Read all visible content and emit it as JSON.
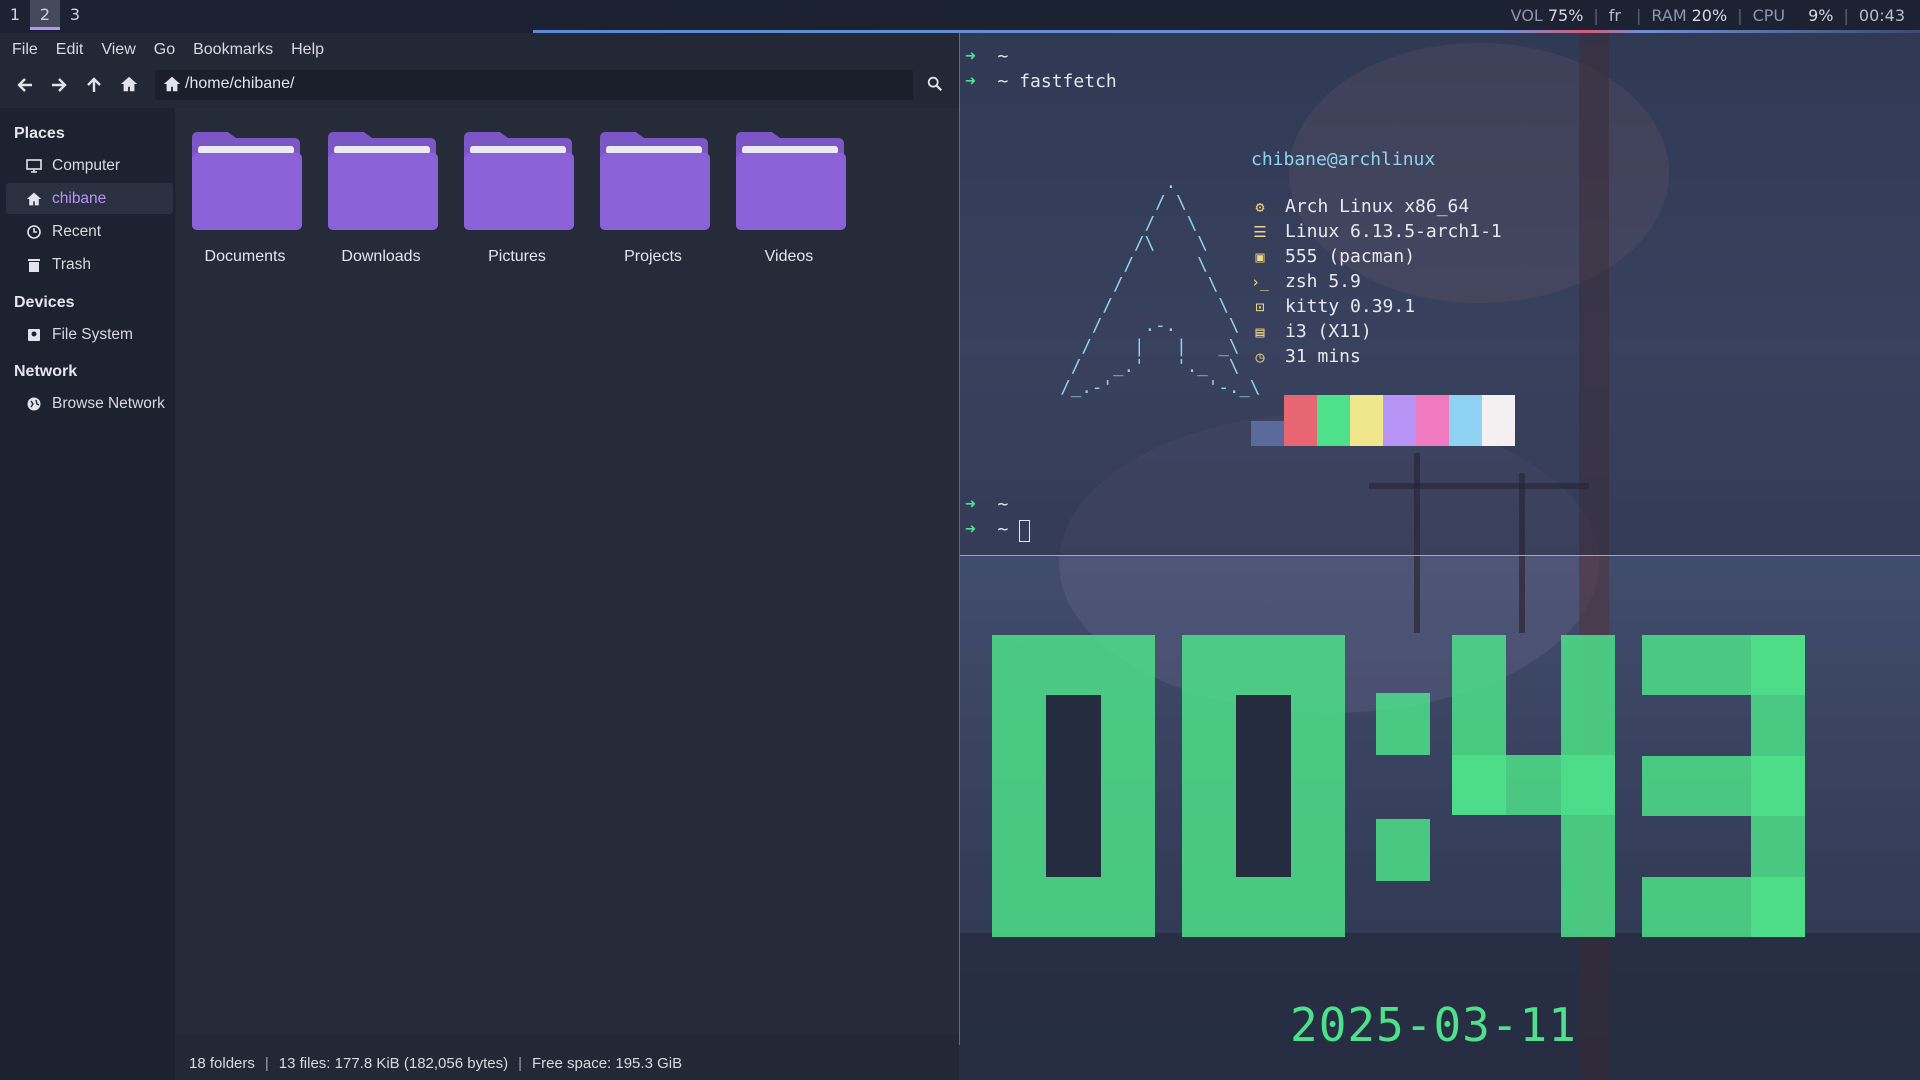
{
  "topbar": {
    "workspaces": [
      "1",
      "2",
      "3"
    ],
    "active_workspace": "2",
    "vol_label": "VOL",
    "vol_value": "75%",
    "layout": "fr",
    "ram_label": "RAM",
    "ram_value": "20%",
    "cpu_label": "CPU",
    "cpu_value": "9%",
    "time": "00:43"
  },
  "filemanager": {
    "menu": [
      "File",
      "Edit",
      "View",
      "Go",
      "Bookmarks",
      "Help"
    ],
    "path": "/home/chibane/",
    "sidebar": {
      "places_header": "Places",
      "places": [
        {
          "label": "Computer",
          "icon": "computer-icon"
        },
        {
          "label": "chibane",
          "icon": "home-icon",
          "active": true
        },
        {
          "label": "Recent",
          "icon": "clock-icon"
        },
        {
          "label": "Trash",
          "icon": "trash-icon"
        }
      ],
      "devices_header": "Devices",
      "devices": [
        {
          "label": "File System",
          "icon": "drive-icon"
        }
      ],
      "network_header": "Network",
      "network": [
        {
          "label": "Browse Network",
          "icon": "globe-icon"
        }
      ]
    },
    "folders": [
      "Documents",
      "Downloads",
      "Pictures",
      "Projects",
      "Videos"
    ],
    "folder_color": "#7c55c6",
    "status": {
      "folders": "18 folders",
      "files": "13 files: 177.8 KiB (182,056 bytes)",
      "free": "Free space: 195.3 GiB"
    }
  },
  "terminal": {
    "prompt_symbol": "➜",
    "lines": [
      "~",
      "~ fastfetch"
    ],
    "userhost": "chibane@archlinux",
    "info": [
      {
        "icon": "gear-icon",
        "text": "Arch Linux x86_64"
      },
      {
        "icon": "server-icon",
        "text": "Linux 6.13.5-arch1-1"
      },
      {
        "icon": "package-icon",
        "text": "555 (pacman)"
      },
      {
        "icon": "shell-icon",
        "text": "zsh 5.9"
      },
      {
        "icon": "terminal-icon",
        "text": "kitty 0.39.1"
      },
      {
        "icon": "window-icon",
        "text": "i3 (X11)"
      },
      {
        "icon": "clock-icon",
        "text": "31 mins"
      }
    ],
    "palette": [
      "#1f2335",
      "#e86671",
      "#4ee08a",
      "#f0e68c",
      "#b794f6",
      "#f07ac0",
      "#8ed3f2",
      "#f4f0f2"
    ],
    "prompt_lines": [
      "~",
      "~"
    ]
  },
  "clock": {
    "time": "00:43",
    "date": "2025-03-11",
    "color": "#4ee08a"
  }
}
